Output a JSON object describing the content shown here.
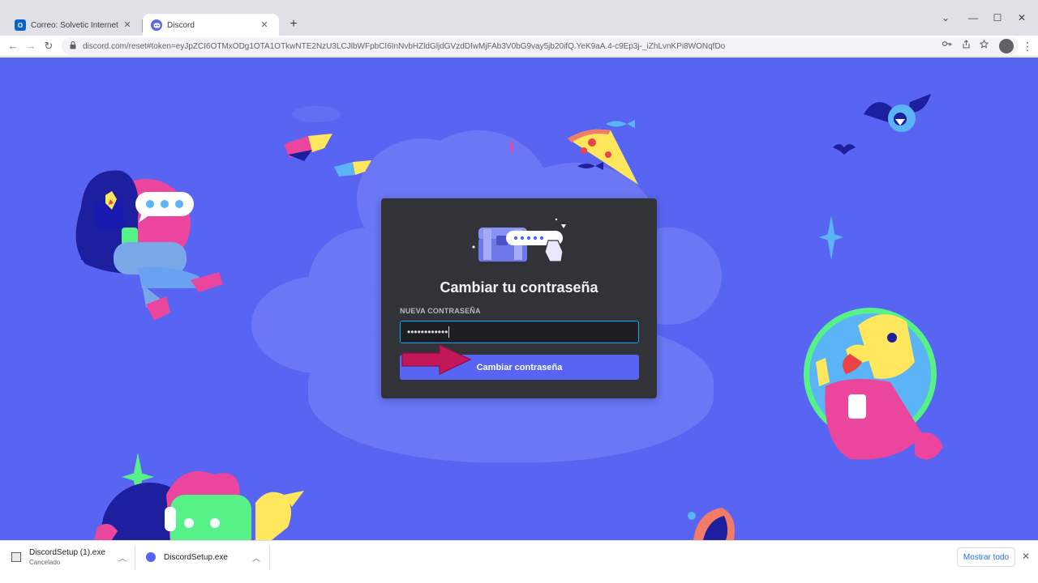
{
  "browser": {
    "tabs": [
      {
        "title": "Correo: Solvetic Internet - Outlo",
        "favicon": "outlook-icon",
        "favicon_text": "O"
      },
      {
        "title": "Discord",
        "favicon": "discord-icon"
      }
    ],
    "new_tab_label": "+",
    "window_controls": {
      "minimize": "—",
      "maximize": "☐",
      "close": "✕",
      "tabs_menu": "⌄"
    },
    "nav": {
      "back": "←",
      "forward": "→",
      "reload": "↻"
    },
    "url": "discord.com/reset#token=eyJpZCI6OTMxODg1OTA1OTkwNTE2NzU3LCJlbWFpbCI6InNvbHZldGljdGVzdDIwMjFAb3V0bG9vay5jb20ifQ.YeK9aA.4-c9Ep3j-_iZhLvnKPi8WONqfDo"
  },
  "reset_modal": {
    "title": "Cambiar tu contraseña",
    "field_label": "NUEVA CONTRASEÑA",
    "password_value": "••••••••••••",
    "submit_label": "Cambiar contraseña"
  },
  "downloads": {
    "items": [
      {
        "name": "DiscordSetup (1).exe",
        "status": "Cancelado"
      },
      {
        "name": "DiscordSetup.exe"
      }
    ],
    "show_all_label": "Mostrar todo",
    "close": "✕"
  },
  "colors": {
    "background": "#5865f2",
    "modal": "#313338",
    "input_border": "#00a8fc",
    "button": "#5865f2",
    "annotation_arrow": "#c2185b"
  }
}
